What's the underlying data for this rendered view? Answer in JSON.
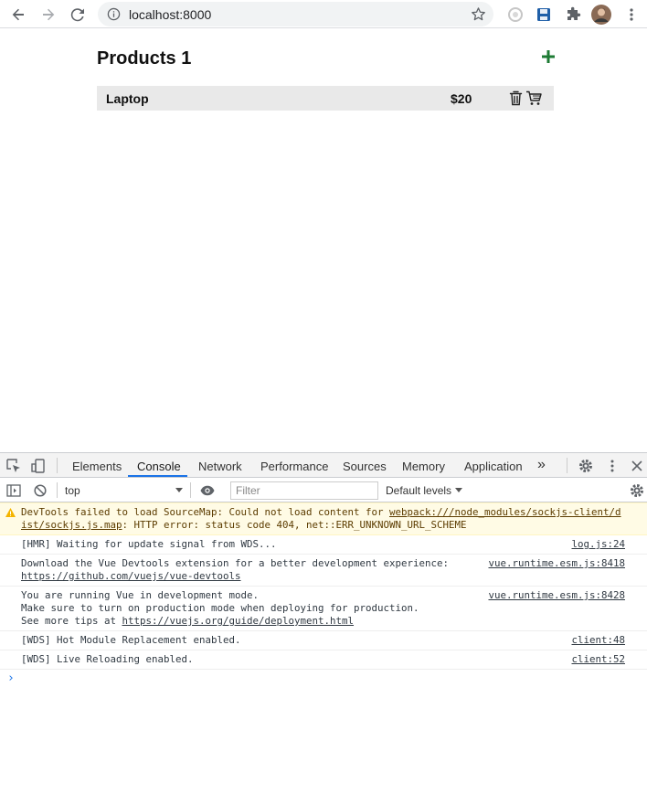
{
  "browser": {
    "url": "localhost:8000"
  },
  "page": {
    "title": "Products 1",
    "products": [
      {
        "name": "Laptop",
        "price": "$20"
      }
    ]
  },
  "devtools": {
    "tabs": [
      "Elements",
      "Console",
      "Network",
      "Performance",
      "Sources",
      "Memory",
      "Application"
    ],
    "active_tab": "Console",
    "more_tabs": "»",
    "context": "top",
    "filter_placeholder": "Filter",
    "levels": "Default levels",
    "messages": [
      {
        "type": "warning",
        "lines": [
          "DevTools failed to load SourceMap: Could not load content for webpack:///node_modules/sockjs-client/d",
          "ist/sockjs.js.map: HTTP error: status code 404, net::ERR_UNKNOWN_URL_SCHEME"
        ],
        "link_text": "webpack:///node_modules/sockjs-client/d",
        "link_text_2": "ist/sockjs.js.map",
        "prefix": "DevTools failed to load SourceMap: Could not load content for ",
        "suffix": ": HTTP error: status code 404, net::ERR_UNKNOWN_URL_SCHEME"
      },
      {
        "type": "log",
        "text": "[HMR] Waiting for update signal from WDS...",
        "source": "log.js:24"
      },
      {
        "type": "log",
        "text": "Download the Vue Devtools extension for a better development experience:",
        "link": "https://github.com/vuejs/vue-devtools",
        "source": "vue.runtime.esm.js:8418"
      },
      {
        "type": "log",
        "text": "You are running Vue in development mode.",
        "text2": "Make sure to turn on production mode when deploying for production.",
        "text3_prefix": "See more tips at ",
        "link": "https://vuejs.org/guide/deployment.html",
        "source": "vue.runtime.esm.js:8428"
      },
      {
        "type": "log",
        "text": "[WDS] Hot Module Replacement enabled.",
        "source": "client:48"
      },
      {
        "type": "log",
        "text": "[WDS] Live Reloading enabled.",
        "source": "client:52"
      }
    ],
    "prompt_symbol": "›"
  },
  "colors": {
    "accent": "#1a73e8",
    "add_icon": "#1e7b34",
    "warning_bg": "#fffbe5"
  }
}
